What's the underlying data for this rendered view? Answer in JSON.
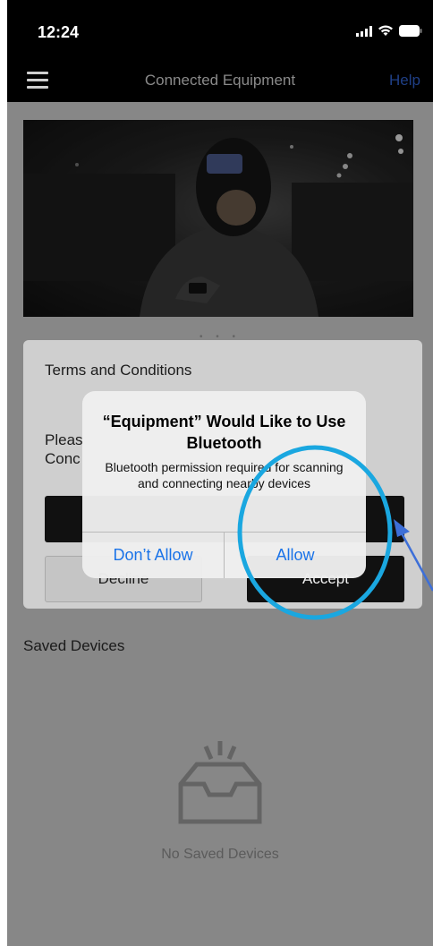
{
  "status_bar": {
    "time": "12:24"
  },
  "nav": {
    "title": "Connected Equipment",
    "help_label": "Help"
  },
  "carousel": {
    "dots": "• • •"
  },
  "terms": {
    "title": "Terms and Conditions",
    "body_partial_line1": "Pleas",
    "body_partial_line2": "Conc",
    "decline_label": "Decline",
    "accept_label": "Accept"
  },
  "saved_devices": {
    "heading": "Saved Devices",
    "empty_text": "No Saved Devices"
  },
  "alert": {
    "title": "“Equipment” Would Like to Use Bluetooth",
    "message": "Bluetooth permission required for scanning and connecting nearby devices",
    "dont_allow_label": "Don’t Allow",
    "allow_label": "Allow"
  },
  "colors": {
    "alert_button": "#1a73e8",
    "annotation_circle": "#1aa7e0",
    "annotation_arrow": "#3d6fd8"
  }
}
